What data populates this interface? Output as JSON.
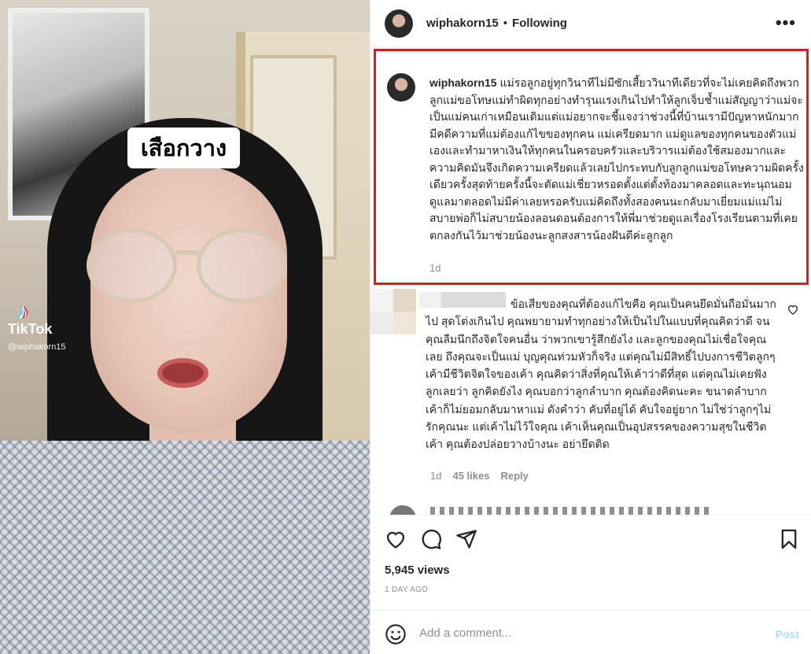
{
  "media": {
    "overlay_text": "เสือกวาง",
    "tiktok_name": "TikTok",
    "tiktok_user": "@wiphakorn15"
  },
  "header": {
    "username": "wiphakorn15",
    "separator": "•",
    "follow_status": "Following",
    "more_label": "•••"
  },
  "caption": {
    "username": "wiphakorn15",
    "text": "แม่รอลูกอยู่ทุกวินาทีไม่มีซักเสี้ยววินาทีเดียวที่จะไม่เคยคิดถึงพวกลูกแม่ขอโทษแม่ทำผิดทุกอย่างทำรุนแรงเกินไปทำให้ลูกเจ็บช้ำแม่สัญญาว่าแม่จะเป็นแม่คนเก่าเหมือนเดิมแต่แม่อยากจะชี้แจงว่าช่วงนี้ที่บ้านเรามีปัญหาหนักมากมีคดีความที่แม่ต้องแก้ไขของทุกคน แม่เครียดมาก แม่ดูแลของทุกคนของตัวแม่เองและทำมาหาเงินให้ทุกคนในครอบครัวและบริวารแม่ต้องใช้สมองมากและความคิดมันจึงเกิดความเครียดแล้วเลยไปกระทบกับลูกลูกแม่ขอโทษความผิดครั้งเดียวครั้งสุดท้ายครั้งนี้จะตัดแม่เชี่ยวหรอดตั้งแต่ตั้งท้องมาคลอดและทะนุถนอมดูแลมาตลอดไม่มีค่าเลยหรอครับแม่คิดถึงทั้งสองคนนะกลับมาเยี่ยมแม่แม่ไม่สบายพ่อก็ไม่สบายน้องลอนดอนต้องการให้พี่มาช่วยดูแลเรื่องโรงเรียนตามที่เคยตกลงกันไว้มาช่วยน้องนะลูกสงสารน้องฝันดีค่ะลูกลูก",
    "time": "1d"
  },
  "comment": {
    "text": "ข้อเสียของคุณที่ต้องแก้ไขคือ คุณเป็นคนยึดมั่นถือมั่นมากไป สุดโต่งเกินไป คุณพยายามทำทุกอย่างให้เป็นไปในแบบที่คุณคิดว่าดี จนคุณลืมนึกถึงจิตใจคนอื่น ว่าพวกเขารู้สึกยังไง และลูกของคุณไม่เชื่อใจคุณเลย ถึงคุณจะเป็นแม่ บุญคุณท่วมหัวก็จริง แต่คุณไม่มีสิทธิ์ไปบงการชีวิตลูกๆ เค้ามีชีวิตจิตใจของเค้า คุณคิดว่าสิ่งที่คุณให้เค้าว่าดีที่สุด แต่คุณไม่เคยฟังลูกเลยว่า ลูกคิดยังไง คุณบอกว่าลูกลำบาก คุณต้องคิดนะคะ ขนาดลำบากเค้าก็ไม่ยอมกลับมาหาแม่ ดังคำว่า คับที่อยู่ได้ คับใจอยู่ยาก ไม่ใช่ว่าลูกๆไม่รักคุณนะ แต่เค้าไม่ไว้ใจคุณ เค้าเห็นคุณเป็นอุปสรรคของความสุขในชีวิตเค้า คุณต้องปล่อยวางบ้างนะ อย่ายึดติด",
    "time": "1d",
    "likes": "45 likes",
    "reply_label": "Reply"
  },
  "stats": {
    "views": "5,945 views",
    "ago": "1 DAY AGO"
  },
  "add_comment": {
    "placeholder": "Add a comment...",
    "post_label": "Post"
  },
  "colors": {
    "highlight_border": "#d81b1b",
    "post_button": "#b3dbff",
    "muted": "#8e8e8e"
  }
}
